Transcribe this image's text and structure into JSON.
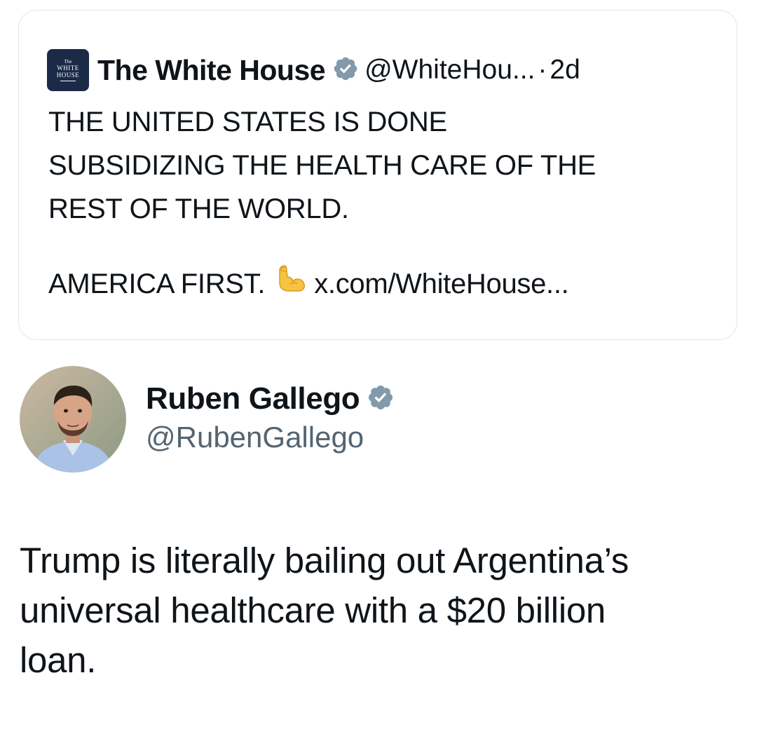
{
  "quoted_tweet": {
    "logo_text": [
      "The",
      "WHITE",
      "HOUSE"
    ],
    "name": "The White House",
    "handle": "@WhiteHou...",
    "separator": "·",
    "time": "2d",
    "body_lines": [
      "THE UNITED STATES IS DONE",
      "SUBSIDIZING THE HEALTH CARE OF THE",
      "REST OF THE WORLD."
    ],
    "last_line_text": "AMERICA FIRST.",
    "link": "x.com/WhiteHouse..."
  },
  "tweet": {
    "author_name": "Ruben Gallego",
    "author_handle": "@RubenGallego",
    "body_lines": [
      "Trump is literally bailing out Argentina’s",
      "universal healthcare with a $20 billion",
      "loan."
    ]
  },
  "icons": {
    "verified_badge": "verified-badge-icon",
    "flexed_biceps": "flexed-biceps-icon"
  },
  "colors": {
    "verified_badge": "#829aab",
    "text": "#0f1419",
    "handle_gray": "#536471",
    "card_border": "#e1e6ea",
    "wh_logo_bg": "#1a2a47"
  }
}
